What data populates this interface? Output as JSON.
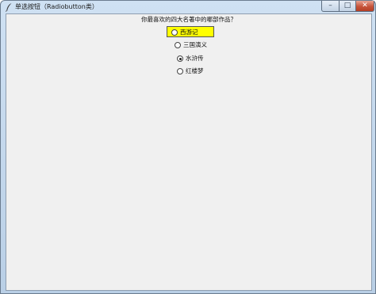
{
  "window": {
    "title": "单选按钮（Radiobutton类）",
    "controls": {
      "minimize": "–",
      "maximize": "□",
      "close": "✕"
    }
  },
  "prompt": {
    "question": "你最喜欢的四大名著中的哪部作品？"
  },
  "options": [
    {
      "label": "西游记",
      "checked": false,
      "highlighted": true
    },
    {
      "label": "三国演义",
      "checked": false,
      "highlighted": false
    },
    {
      "label": "水浒传",
      "checked": true,
      "highlighted": false
    },
    {
      "label": "红楼梦",
      "checked": false,
      "highlighted": false
    }
  ],
  "colors": {
    "highlight": "#ffff00",
    "client_background": "#f0f0f0",
    "titlebar": "#c8dcf0",
    "close_button": "#c6543a"
  },
  "icons": {
    "app": "feather-icon"
  }
}
